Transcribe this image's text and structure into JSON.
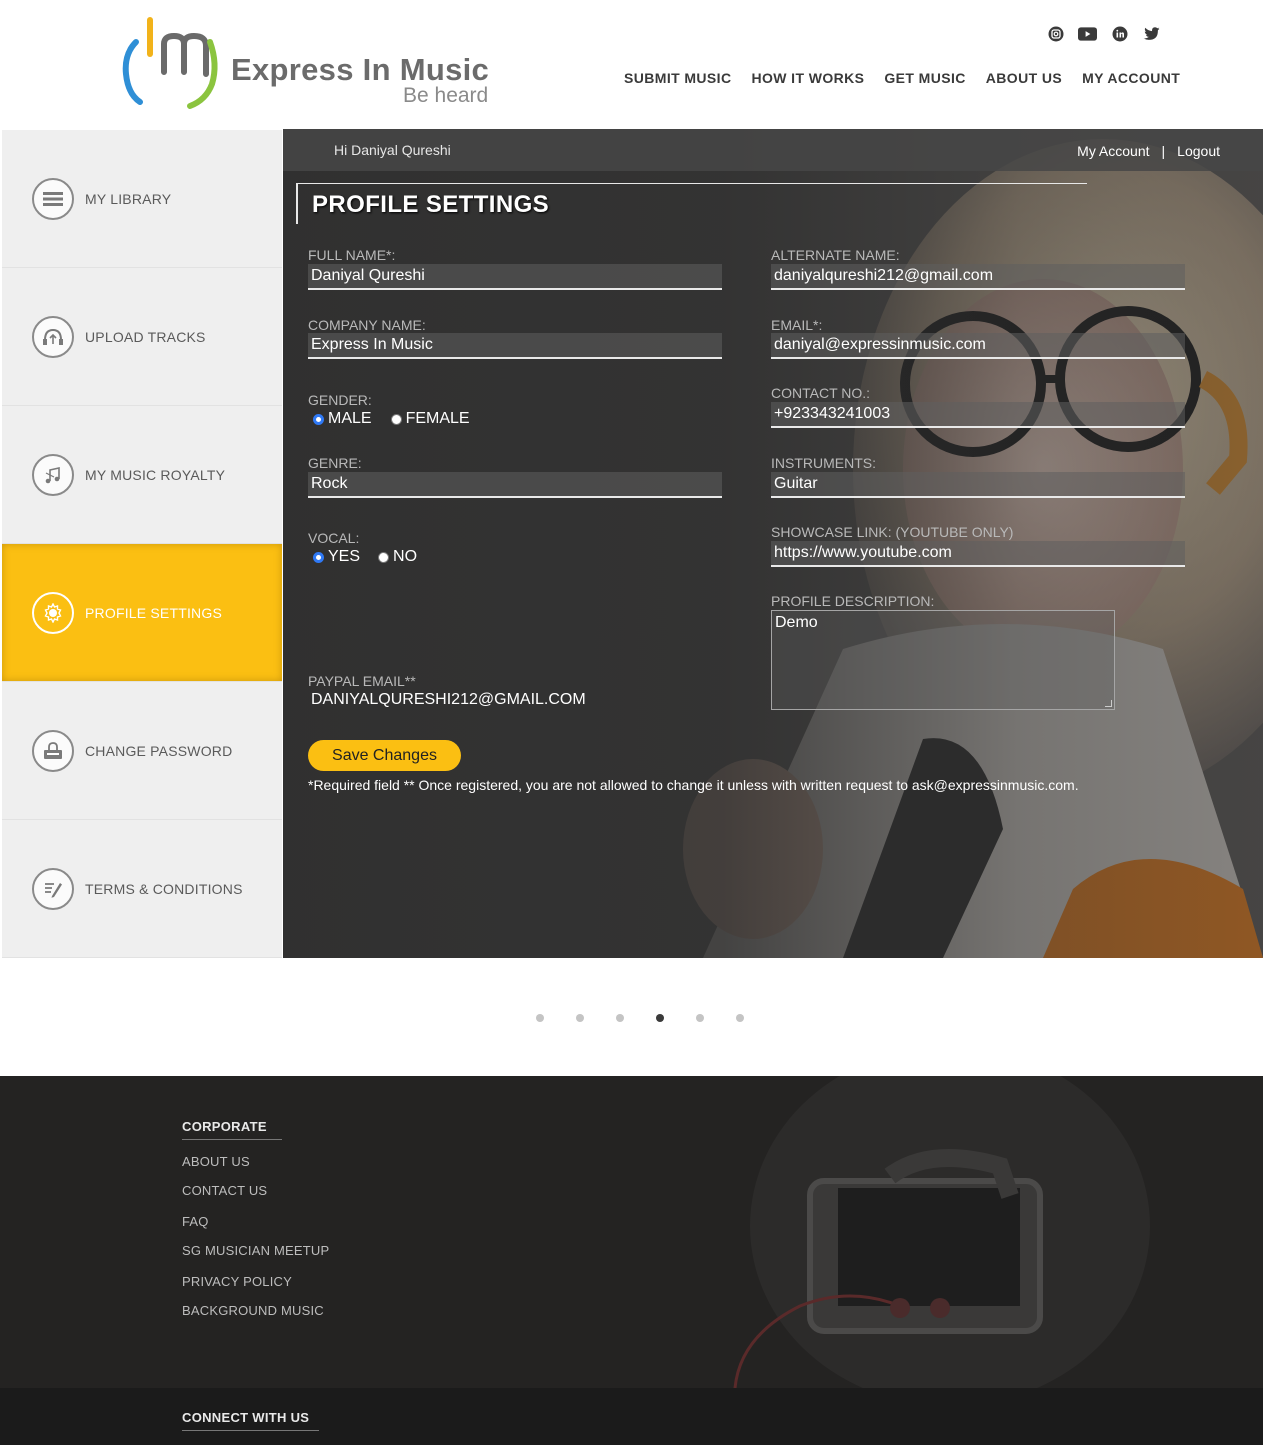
{
  "brand": {
    "title": "Express In Music",
    "tagline": "Be heard"
  },
  "social": [
    "instagram-icon",
    "youtube-icon",
    "linkedin-icon",
    "twitter-icon"
  ],
  "nav": [
    "SUBMIT MUSIC",
    "HOW IT WORKS",
    "GET MUSIC",
    "ABOUT US",
    "MY ACCOUNT"
  ],
  "sidebar": {
    "items": [
      {
        "label": "MY LIBRARY",
        "icon": "library-icon"
      },
      {
        "label": "UPLOAD TRACKS",
        "icon": "upload-tracks-icon"
      },
      {
        "label": "MY MUSIC ROYALTY",
        "icon": "royalty-icon"
      },
      {
        "label": "PROFILE SETTINGS",
        "icon": "profile-settings-icon",
        "active": true
      },
      {
        "label": "CHANGE PASSWORD",
        "icon": "lock-icon"
      },
      {
        "label": "TERMS & CONDITIONS",
        "icon": "terms-icon"
      }
    ]
  },
  "panel": {
    "greeting": "Hi Daniyal Qureshi",
    "my_account": "My Account",
    "separator": "|",
    "logout": "Logout",
    "title": "PROFILE SETTINGS"
  },
  "form": {
    "full_name_label": "FULL NAME*:",
    "full_name": "Daniyal Qureshi",
    "alt_name_label": "ALTERNATE NAME:",
    "alt_name": "daniyalqureshi212@gmail.com",
    "company_label": "COMPANY NAME:",
    "company": "Express In Music",
    "email_label": "EMAIL*:",
    "email": "daniyal@expressinmusic.com",
    "gender_label": "GENDER:",
    "gender_male": "MALE",
    "gender_female": "FEMALE",
    "contact_label": "CONTACT NO.:",
    "contact": "+923343241003",
    "genre_label": "GENRE:",
    "genre": "Rock",
    "instruments_label": "INSTRUMENTS:",
    "instruments": "Guitar",
    "vocal_label": "VOCAL:",
    "vocal_yes": "YES",
    "vocal_no": "NO",
    "showcase_label": "SHOWCASE LINK: (YOUTUBE ONLY)",
    "showcase": "https://www.youtube.com",
    "description_label": "PROFILE DESCRIPTION:",
    "description": "Demo",
    "paypal_label": "PAYPAL EMAIL**",
    "paypal": "DANIYALQURESHI212@GMAIL.COM",
    "save_label": "Save Changes",
    "note": "*Required field   ** Once registered, you are not allowed to change it unless with written request to ask@expressinmusic.com."
  },
  "carousel": {
    "count": 6,
    "active_index": 3
  },
  "footer": {
    "corporate_title": "CORPORATE",
    "links": [
      "ABOUT US",
      "CONTACT US",
      "FAQ",
      "SG MUSICIAN MEETUP",
      "PRIVACY POLICY",
      "BACKGROUND MUSIC"
    ],
    "connect_title": "CONNECT WITH US"
  },
  "colors": {
    "accent": "#fbbf12",
    "sidebar_bg": "#efefef",
    "panel_bg": "#3f3e3d",
    "footer_bg": "#242322"
  }
}
